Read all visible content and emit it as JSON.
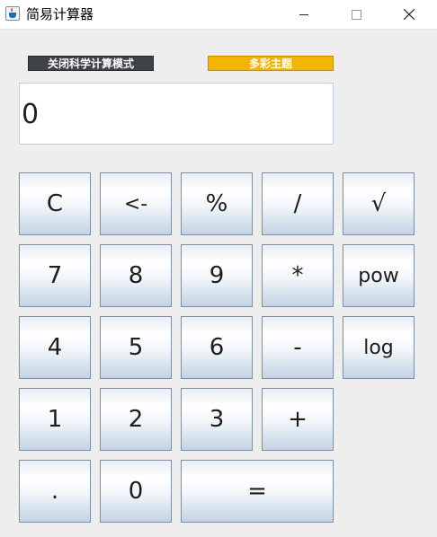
{
  "window": {
    "title": "简易计算器"
  },
  "controls": {
    "mode_label": "关闭科学计算模式",
    "theme_label": "多彩主题"
  },
  "display": {
    "value": "0"
  },
  "keys": {
    "clear": "C",
    "backspace": "<-",
    "percent": "%",
    "divide": "/",
    "sqrt": "√",
    "seven": "7",
    "eight": "8",
    "nine": "9",
    "multiply": "*",
    "pow": "pow",
    "four": "4",
    "five": "5",
    "six": "6",
    "minus": "-",
    "log": "log",
    "one": "1",
    "two": "2",
    "three": "3",
    "plus": "+",
    "dot": ".",
    "zero": "0",
    "equals": "="
  },
  "colors": {
    "theme_button": "#f5b400",
    "mode_button": "#3f4348"
  }
}
